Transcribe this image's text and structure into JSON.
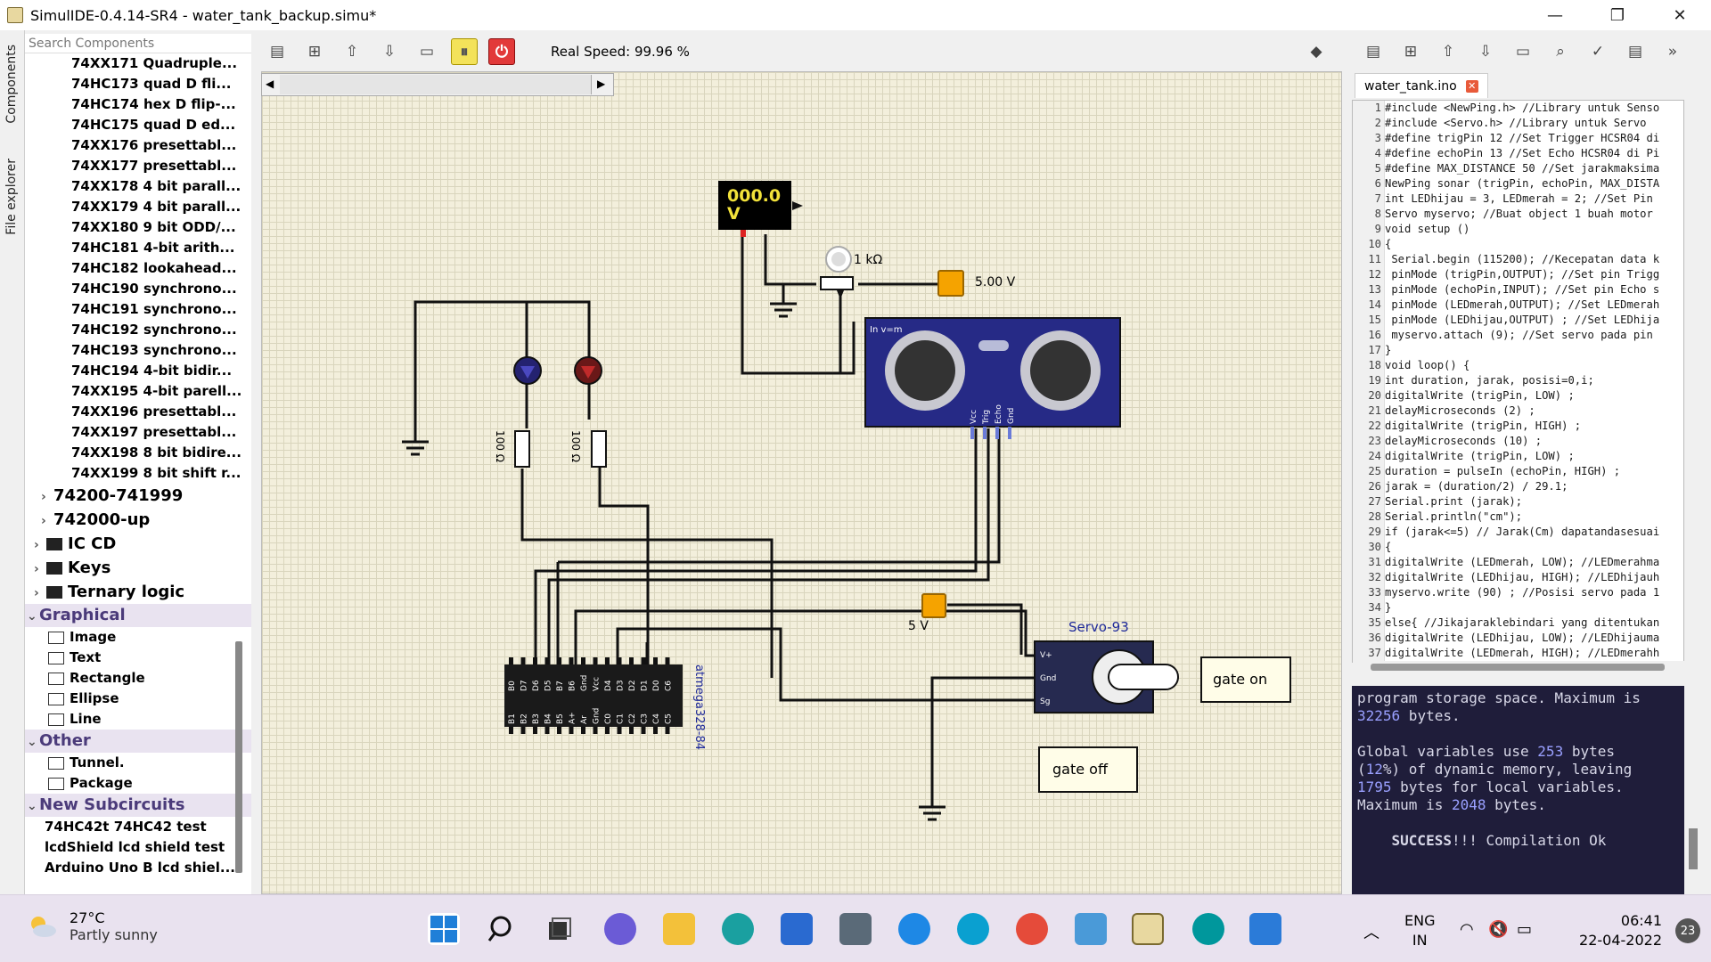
{
  "window": {
    "title": "SimulIDE-0.4.14-SR4  -  water_tank_backup.simu*",
    "min": "—",
    "max": "❐",
    "close": "✕"
  },
  "sidebar": {
    "tab_components": "Components",
    "tab_file_explorer": "File explorer"
  },
  "search": {
    "placeholder": "Search Components"
  },
  "components": {
    "ic_items": [
      "74XX171  Quadruple...",
      "74HC173  quad D fli...",
      "74HC174  hex D flip-...",
      "74HC175  quad D ed...",
      "74XX176  presettabl...",
      "74XX177  presettabl...",
      "74XX178  4 bit parall...",
      "74XX179  4 bit parall...",
      "74XX180  9 bit ODD/...",
      "74HC181  4-bit arith...",
      "74HC182  lookahead...",
      "74HC190  synchrono...",
      "74HC191  synchrono...",
      "74HC192  synchrono...",
      "74HC193  synchrono...",
      "74HC194  4-bit bidir...",
      "74XX195  4-bit parell...",
      "74XX196  presettabl...",
      "74XX197  presettabl...",
      "74XX198  8 bit bidire...",
      "74XX199  8 bit shift r..."
    ],
    "groups": [
      "74200-741999",
      "742000-up"
    ],
    "folders": [
      "IC CD",
      "Keys",
      "Ternary logic"
    ],
    "graphical": {
      "label": "Graphical",
      "items": [
        "Image",
        "Text",
        "Rectangle",
        "Ellipse",
        "Line"
      ]
    },
    "other": {
      "label": "Other",
      "items": [
        "Tunnel.",
        "Package"
      ]
    },
    "new_subcircuits": {
      "label": "New Subcircuits",
      "items": [
        "74HC42t 74HC42 test",
        "lcdShield lcd shield test",
        "Arduino Uno B lcd shiel..."
      ]
    }
  },
  "toolbar": {
    "real_speed": "Real Speed: 99.96 %"
  },
  "editor": {
    "tab": "water_tank.ino",
    "lines": [
      "#include <NewPing.h> //Library untuk Senso",
      "#include <Servo.h> //Library untuk Servo",
      "#define trigPin 12 //Set Trigger HCSR04 di",
      "#define echoPin 13 //Set Echo HCSR04 di Pi",
      "#define MAX_DISTANCE 50 //Set jarakmaksima",
      "NewPing sonar (trigPin, echoPin, MAX_DISTA",
      "int LEDhijau = 3, LEDmerah = 2; //Set Pin",
      "Servo myservo; //Buat object 1 buah motor",
      "void setup ()",
      "{",
      " Serial.begin (115200); //Kecepatan data k",
      " pinMode (trigPin,OUTPUT); //Set pin Trigg",
      " pinMode (echoPin,INPUT); //Set pin Echo s",
      " pinMode (LEDmerah,OUTPUT); //Set LEDmerah",
      " pinMode (LEDhijau,OUTPUT) ; //Set LEDhija",
      " myservo.attach (9); //Set servo pada pin",
      "}",
      "void loop() {",
      "int duration, jarak, posisi=0,i;",
      "digitalWrite (trigPin, LOW) ;",
      "delayMicroseconds (2) ;",
      "digitalWrite (trigPin, HIGH) ;",
      "delayMicroseconds (10) ;",
      "digitalWrite (trigPin, LOW) ;",
      "duration = pulseIn (echoPin, HIGH) ;",
      "jarak = (duration/2) / 29.1;",
      "Serial.print (jarak);",
      "Serial.println(\"cm\");",
      "if (jarak<=5) // Jarak(Cm) dapatandasesuai",
      "{",
      "digitalWrite (LEDmerah, LOW); //LEDmerahma",
      "digitalWrite (LEDhijau, HIGH); //LEDhijauh",
      "myservo.write (90) ; //Posisi servo pada 1",
      "}",
      "else{ //Jikajaraklebindari yang ditentukan",
      "digitalWrite (LEDhijau, LOW); //LEDhijauma",
      "digitalWrite (LEDmerah, HIGH); //LEDmerahh"
    ]
  },
  "console": {
    "l1": "program storage space. Maximum is",
    "l2_num": "32256",
    "l2_txt": " bytes.",
    "l3a": "Global variables use ",
    "l3_num": "253",
    "l3b": " bytes",
    "l4a": "(",
    "l4_num": "12",
    "l4b": "%) of dynamic memory, leaving",
    "l5_num": "1795",
    "l5b": " bytes for local variables.",
    "l6a": "Maximum is ",
    "l6_num": "2048",
    "l6b": " bytes.",
    "success_bold": "SUCCESS",
    "success_rest": "!!! Compilation Ok"
  },
  "circuit": {
    "voltmeter": "000.0\nV",
    "pot_label": "1 kΩ",
    "fixed_voltage": "5.00 V",
    "res1": "100 Ω",
    "res2": "100 Ω",
    "sonar_label": "In v=m",
    "sonar_pins": [
      "Vcc",
      "Trig",
      "Echo",
      "Gnd"
    ],
    "servo_title": "Servo-93",
    "servo_pins": [
      "V+",
      "Gnd",
      "Sg"
    ],
    "servo_volt": "5 V",
    "mcu_label": "atmega328-84",
    "mcu_top_pins": [
      "B0",
      "D7",
      "D6",
      "D5",
      "B7",
      "B6",
      "Gnd",
      "Vcc",
      "D4",
      "D3",
      "D2",
      "D1",
      "D0",
      "C6"
    ],
    "mcu_bot_pins": [
      "B1",
      "B2",
      "B3",
      "B4",
      "B5",
      "A+",
      "Ar",
      "Gnd",
      "C0",
      "C1",
      "C2",
      "C3",
      "C4",
      "C5"
    ],
    "gate_on": "gate on",
    "gate_off": "gate off"
  },
  "taskbar": {
    "temp": "27°C",
    "weather": "Partly sunny",
    "lang1": "ENG",
    "lang2": "IN",
    "time": "06:41",
    "date": "22-04-2022",
    "badge": "23"
  }
}
